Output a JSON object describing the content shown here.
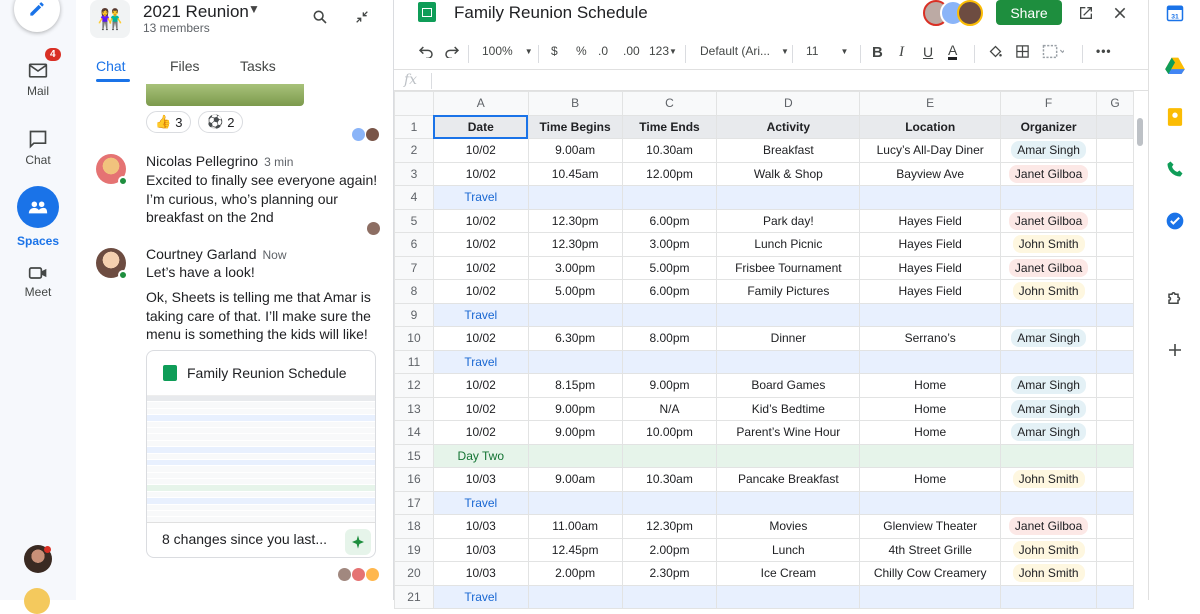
{
  "rail": {
    "items": [
      {
        "label": "Mail",
        "badge": "4"
      },
      {
        "label": "Chat"
      },
      {
        "label": "Spaces"
      },
      {
        "label": "Meet"
      }
    ]
  },
  "chat": {
    "space_name": "2021 Reunion",
    "members": "13 members",
    "tabs": [
      "Chat",
      "Files",
      "Tasks"
    ],
    "reactions": [
      {
        "emoji": "👍",
        "count": "3"
      },
      {
        "emoji": "⚽",
        "count": "2"
      }
    ],
    "messages": [
      {
        "author": "Nicolas Pellegrino",
        "time": "3 min",
        "text": "Excited to finally see everyone again! I’m curious, who’s planning our breakfast on the 2nd"
      },
      {
        "author": "Courtney Garland",
        "time": "Now",
        "text1": "Let’s have a look!",
        "text2": "Ok, Sheets is telling me that Amar is taking care of that. I’ll make sure the menu is something the kids will like!"
      }
    ],
    "card": {
      "title": "Family Reunion Schedule",
      "footer": "8 changes since you last..."
    }
  },
  "sheet": {
    "title": "Family Reunion Schedule",
    "share_label": "Share",
    "toolbar": {
      "zoom": "100%",
      "currency": "$",
      "percent": "%",
      "dec1": ".0",
      "dec2": ".00",
      "format": "123",
      "font": "Default (Ari...",
      "size": "11"
    },
    "fx": "fx",
    "columns": [
      "A",
      "B",
      "C",
      "D",
      "E",
      "F",
      "G"
    ],
    "header": [
      "Date",
      "Time Begins",
      "Time Ends",
      "Activity",
      "Location",
      "Organizer"
    ],
    "rows": [
      {
        "n": "2",
        "cells": [
          "10/02",
          "9.00am",
          "10.30am",
          "Breakfast",
          "Lucy’s All-Day Diner",
          "Amar Singh"
        ]
      },
      {
        "n": "3",
        "cells": [
          "10/02",
          "10.45am",
          "12.00pm",
          "Walk & Shop",
          "Bayview Ave",
          "Janet Gilboa"
        ]
      },
      {
        "n": "4",
        "label": "Travel",
        "kind": "travel"
      },
      {
        "n": "5",
        "cells": [
          "10/02",
          "12.30pm",
          "6.00pm",
          "Park day!",
          "Hayes Field",
          "Janet Gilboa"
        ]
      },
      {
        "n": "6",
        "cells": [
          "10/02",
          "12.30pm",
          "3.00pm",
          "Lunch Picnic",
          "Hayes Field",
          "John Smith"
        ]
      },
      {
        "n": "7",
        "cells": [
          "10/02",
          "3.00pm",
          "5.00pm",
          "Frisbee Tournament",
          "Hayes Field",
          "Janet Gilboa"
        ]
      },
      {
        "n": "8",
        "cells": [
          "10/02",
          "5.00pm",
          "6.00pm",
          "Family Pictures",
          "Hayes Field",
          "John Smith"
        ]
      },
      {
        "n": "9",
        "label": "Travel",
        "kind": "travel"
      },
      {
        "n": "10",
        "cells": [
          "10/02",
          "6.30pm",
          "8.00pm",
          "Dinner",
          "Serrano’s",
          "Amar Singh"
        ]
      },
      {
        "n": "11",
        "label": "Travel",
        "kind": "travel"
      },
      {
        "n": "12",
        "cells": [
          "10/02",
          "8.15pm",
          "9.00pm",
          "Board Games",
          "Home",
          "Amar Singh"
        ]
      },
      {
        "n": "13",
        "cells": [
          "10/02",
          "9.00pm",
          "N/A",
          "Kid’s Bedtime",
          "Home",
          "Amar Singh"
        ]
      },
      {
        "n": "14",
        "cells": [
          "10/02",
          "9.00pm",
          "10.00pm",
          "Parent’s Wine Hour",
          "Home",
          "Amar Singh"
        ]
      },
      {
        "n": "15",
        "label": "Day Two",
        "kind": "day"
      },
      {
        "n": "16",
        "cells": [
          "10/03",
          "9.00am",
          "10.30am",
          "Pancake Breakfast",
          "Home",
          "John Smith"
        ]
      },
      {
        "n": "17",
        "label": "Travel",
        "kind": "travel"
      },
      {
        "n": "18",
        "cells": [
          "10/03",
          "11.00am",
          "12.30pm",
          "Movies",
          "Glenview Theater",
          "Janet Gilboa"
        ]
      },
      {
        "n": "19",
        "cells": [
          "10/03",
          "12.45pm",
          "2.00pm",
          "Lunch",
          "4th Street Grille",
          "John Smith"
        ]
      },
      {
        "n": "20",
        "cells": [
          "10/03",
          "2.00pm",
          "2.30pm",
          "Ice Cream",
          "Chilly Cow Creamery",
          "John Smith"
        ]
      },
      {
        "n": "21",
        "label": "Travel",
        "kind": "travel"
      }
    ]
  },
  "colors": {
    "accent": "#1a73e8",
    "share": "#1e8e3e",
    "travel_bg": "#e8f0fe",
    "day_bg": "#e6f4ea"
  }
}
